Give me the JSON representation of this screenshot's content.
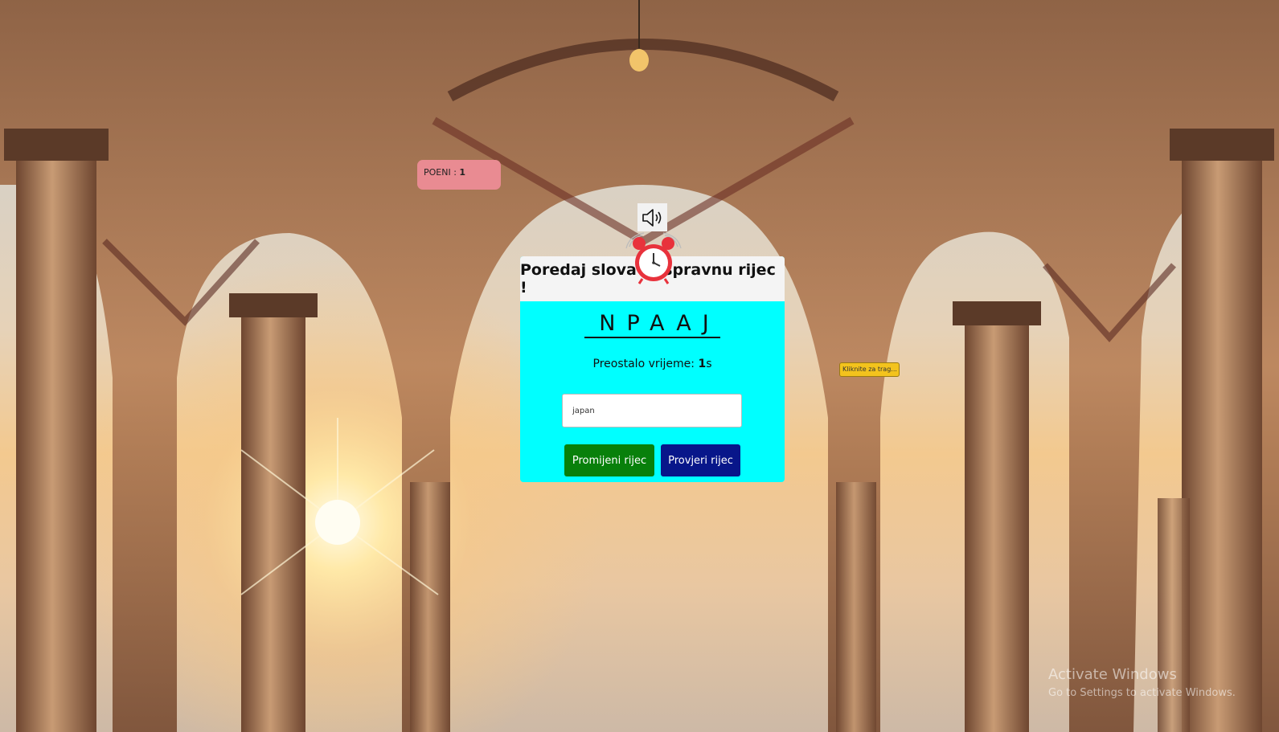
{
  "points": {
    "label": "POENI : ",
    "value": "1"
  },
  "sound": {
    "icon": "speaker-icon"
  },
  "timer_icon": "alarm-clock-icon",
  "card": {
    "heading": "Poredaj slova u ispravnu rijec !",
    "scrambled_word": "NPAAJ",
    "time_label": "Preostalo vrijeme: ",
    "time_value": "1",
    "time_unit": "s",
    "input_value": "japan",
    "change_button": "Promijeni rijec",
    "check_button": "Provjeri rijec"
  },
  "hint_label": "Kliknite za trag...",
  "watermark": {
    "title": "Activate Windows",
    "subtitle": "Go to Settings to activate Windows."
  },
  "colors": {
    "card_bg": "#00ffff",
    "card_head_bg": "#f4f4f4",
    "points_bg": "#e98b92",
    "change_button_bg": "#08800b",
    "check_button_bg": "#08168a",
    "hint_bg": "#f3c31d"
  }
}
